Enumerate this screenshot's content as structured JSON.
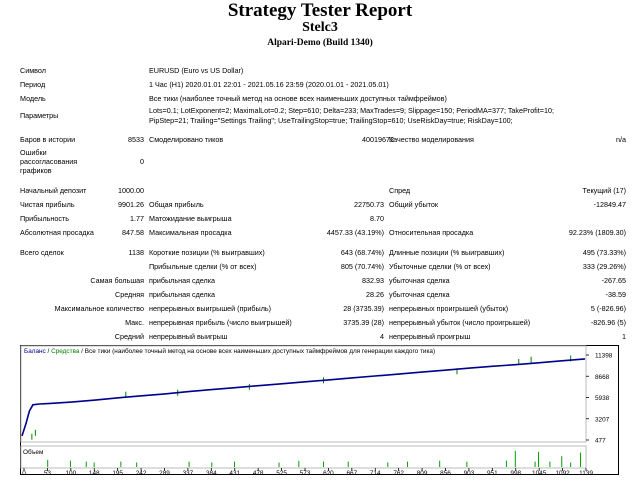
{
  "report": {
    "title": "Strategy Tester Report",
    "expert": "Stelc3",
    "account": "Alpari-Demo (Build 1340)"
  },
  "info": {
    "symbol_label": "Символ",
    "symbol_value": "EURUSD (Euro vs US Dollar)",
    "period_label": "Период",
    "period_value": "1 Час (H1) 2020.01.01 22:01 - 2021.05.16 23:59 (2020.01.01 - 2021.05.01)",
    "model_label": "Модель",
    "model_value": "Все тики (наиболее точный метод на основе всех наименьших доступных таймфреймов)",
    "params_label": "Параметры",
    "params_line1": "Lots=0.1; LotExponent=2; MaximalLot=0.2; Step=610; Delta=233; MaxTrades=9; Slippage=150; PeriodMA=377; TakeProfit=10;",
    "params_line2": "PipStep=21; Trailing=\"Settings Trailing\"; UseTrailingStop=true; TrailingStop=610; UseRiskDay=true; RiskDay=100;"
  },
  "stats": {
    "bars_label": "Баров в истории",
    "bars_value": "8533",
    "ticks_label": "Смоделировано тиков",
    "ticks_value": "40019672",
    "quality_label": "Качество моделирования",
    "quality_value": "n/a",
    "errors_label_1": "Ошибки",
    "errors_label_2": "рассогласования",
    "errors_label_3": "графиков",
    "errors_value": "0",
    "deposit_label": "Начальный депозит",
    "deposit_value": "1000.00",
    "spread_label": "Спред",
    "spread_value": "Текущий (17)",
    "net_label": "Чистая прибыль",
    "net_value": "9901.26",
    "gross_profit_label": "Общая прибыль",
    "gross_profit_value": "22750.73",
    "gross_loss_label": "Общий убыток",
    "gross_loss_value": "-12849.47",
    "pf_label": "Прибыльность",
    "pf_value": "1.77",
    "ep_label": "Матожидание выигрыша",
    "ep_value": "8.70",
    "abs_dd_label": "Абсолютная просадка",
    "abs_dd_value": "847.58",
    "max_dd_label": "Максимальная просадка",
    "max_dd_value": "4457.33 (43.19%)",
    "rel_dd_label": "Относительная просадка",
    "rel_dd_value": "92.23% (1809.30)",
    "total_label": "Всего сделок",
    "total_value": "1138",
    "short_label": "Короткие позиции (% выигравших)",
    "short_value": "643 (68.74%)",
    "long_label": "Длинные позиции (% выигравших)",
    "long_value": "495 (73.33%)",
    "prof_trades_label": "Прибыльные сделки (% от всех)",
    "prof_trades_value": "805 (70.74%)",
    "loss_trades_label": "Убыточные сделки (% от всех)",
    "loss_trades_value": "333 (29.26%)",
    "largest_label": "Самая большая",
    "largest_profit_label": "прибыльная сделка",
    "largest_profit_value": "832.93",
    "largest_loss_label": "убыточная сделка",
    "largest_loss_value": "-267.65",
    "average_label": "Средняя",
    "average_profit_label": "прибыльная сделка",
    "average_profit_value": "28.26",
    "average_loss_label": "убыточная сделка",
    "average_loss_value": "-38.59",
    "max_count_label": "Максимальное количество",
    "max_cons_wins_label": "непрерывных выигрышей (прибыль)",
    "max_cons_wins_value": "28 (3735.39)",
    "max_cons_losses_label": "непрерывных проигрышей (убыток)",
    "max_cons_losses_value": "5 (-826.96)",
    "max_label": "Макс.",
    "max_cons_profit_label": "непрерывная прибыль (число выигрышей)",
    "max_cons_profit_value": "3735.39 (28)",
    "max_cons_loss_label": "непрерывный убыток (число проигрышей)",
    "max_cons_loss_value": "-826.96 (5)",
    "avg_label": "Средний",
    "avg_cons_wins_label": "непрерывный выигрыш",
    "avg_cons_wins_value": "4",
    "avg_cons_losses_label": "непрерывный проигрыш",
    "avg_cons_losses_value": "1"
  },
  "chart_data": {
    "type": "line",
    "legend_balance": "Баланс",
    "legend_equity": "Средства",
    "legend_tail": "Все тики (наиболее точный метод на основе всех наименьших доступных таймфреймов для генерации каждого тика)",
    "volume_label": "Объем",
    "y_ticks": [
      "11398",
      "8668",
      "5938",
      "3207",
      "477"
    ],
    "x_ticks": [
      "0",
      "53",
      "100",
      "148",
      "195",
      "242",
      "289",
      "337",
      "384",
      "431",
      "478",
      "525",
      "573",
      "620",
      "667",
      "714",
      "762",
      "809",
      "856",
      "903",
      "951",
      "998",
      "1045",
      "1092",
      "1139"
    ],
    "ylim": [
      477,
      11398
    ],
    "xlim": [
      0,
      1139
    ],
    "balance": [
      [
        0,
        1000
      ],
      [
        8,
        2600
      ],
      [
        15,
        4200
      ],
      [
        22,
        5000
      ],
      [
        35,
        5100
      ],
      [
        53,
        5150
      ],
      [
        100,
        5350
      ],
      [
        148,
        5600
      ],
      [
        195,
        5900
      ],
      [
        242,
        6150
      ],
      [
        289,
        6400
      ],
      [
        337,
        6700
      ],
      [
        384,
        6950
      ],
      [
        431,
        7200
      ],
      [
        478,
        7450
      ],
      [
        525,
        7700
      ],
      [
        573,
        7950
      ],
      [
        620,
        8200
      ],
      [
        667,
        8450
      ],
      [
        714,
        8700
      ],
      [
        762,
        8950
      ],
      [
        809,
        9200
      ],
      [
        856,
        9450
      ],
      [
        903,
        9700
      ],
      [
        951,
        9950
      ],
      [
        998,
        10150
      ],
      [
        1045,
        10400
      ],
      [
        1092,
        10650
      ],
      [
        1139,
        10900
      ]
    ],
    "equity_spikes": [
      [
        20,
        900
      ],
      [
        27,
        1400
      ],
      [
        210,
        6300
      ],
      [
        315,
        6550
      ],
      [
        460,
        7300
      ],
      [
        610,
        8150
      ],
      [
        880,
        9300
      ],
      [
        1005,
        10500
      ],
      [
        1030,
        10800
      ],
      [
        1110,
        10950
      ]
    ],
    "volume_spikes": [
      [
        52,
        0.4
      ],
      [
        98,
        0.35
      ],
      [
        130,
        0.3
      ],
      [
        146,
        0.25
      ],
      [
        200,
        0.3
      ],
      [
        232,
        0.25
      ],
      [
        338,
        0.3
      ],
      [
        384,
        0.25
      ],
      [
        430,
        0.3
      ],
      [
        520,
        0.25
      ],
      [
        560,
        0.35
      ],
      [
        610,
        0.3
      ],
      [
        660,
        0.3
      ],
      [
        740,
        0.25
      ],
      [
        780,
        0.3
      ],
      [
        845,
        0.35
      ],
      [
        900,
        0.3
      ],
      [
        980,
        0.35
      ],
      [
        998,
        0.9
      ],
      [
        1038,
        0.3
      ],
      [
        1045,
        0.85
      ],
      [
        1068,
        0.3
      ],
      [
        1092,
        0.6
      ],
      [
        1110,
        0.25
      ],
      [
        1130,
        0.8
      ]
    ]
  }
}
